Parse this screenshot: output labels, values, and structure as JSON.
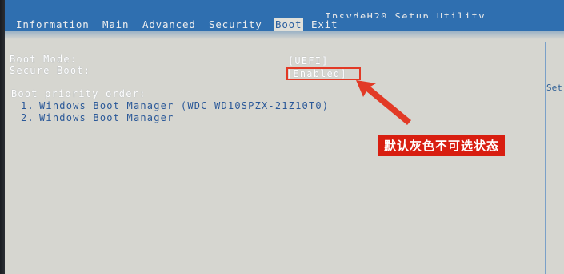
{
  "app_title": "InsydeH20 Setup Utility",
  "tabs": [
    {
      "label": "Information"
    },
    {
      "label": "Main"
    },
    {
      "label": "Advanced"
    },
    {
      "label": "Security"
    },
    {
      "label": "Boot",
      "active": true
    },
    {
      "label": "Exit"
    }
  ],
  "settings": {
    "boot_mode": {
      "label": "Boot Mode:",
      "value": "[UEFI]"
    },
    "secure_boot": {
      "label": "Secure Boot:",
      "value": "[Enabled]"
    }
  },
  "boot_priority": {
    "heading": "Boot priority order:",
    "items": [
      {
        "index": "1.",
        "name": "Windows Boot Manager (WDC WD10SPZX-21Z10T0)"
      },
      {
        "index": "2.",
        "name": "Windows Boot Manager"
      }
    ]
  },
  "help_panel": {
    "fragment": "Set"
  },
  "annotation": {
    "text": "默认灰色不可选状态",
    "color": "#d81e10"
  },
  "colors": {
    "tab_bar": "#2f6fb0",
    "screen_bg": "#d6d6d0",
    "highlight": "#e23a26"
  }
}
